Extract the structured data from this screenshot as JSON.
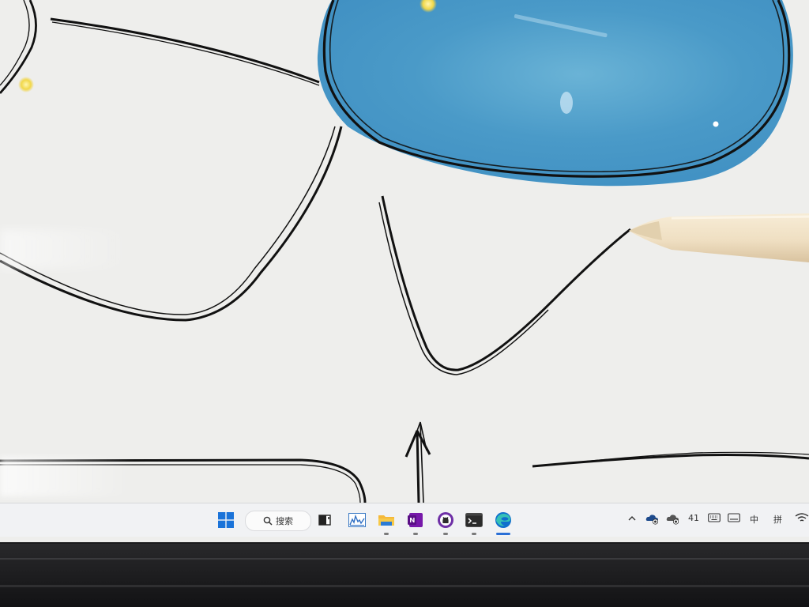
{
  "taskbar": {
    "search": {
      "label": "搜索"
    },
    "apps": [
      {
        "name": "start",
        "icon": "windows-logo-icon"
      },
      {
        "name": "search",
        "icon": "search-icon"
      },
      {
        "name": "task-view",
        "icon": "task-view-icon"
      },
      {
        "name": "performance",
        "icon": "performance-chart-icon"
      },
      {
        "name": "file-explorer",
        "icon": "folder-icon",
        "running": true
      },
      {
        "name": "onenote",
        "icon": "onenote-icon",
        "running": true
      },
      {
        "name": "github",
        "icon": "github-icon",
        "running": true
      },
      {
        "name": "terminal",
        "icon": "terminal-icon",
        "running": true
      },
      {
        "name": "edge",
        "icon": "edge-icon",
        "active": true
      }
    ],
    "tray": {
      "overflow_icon": "chevron-up-icon",
      "cloud_icon": "onedrive-icon",
      "status_icon": "cloud-status-icon",
      "count": "41",
      "keyboard_icon": "keyboard-icon",
      "tablet_icon": "touchpad-icon",
      "ime_mode": "中",
      "ime_input": "拼",
      "wifi_icon": "wifi-icon"
    }
  },
  "canvas": {
    "ink_color": "#111111",
    "fill_color": "#4a9ac8",
    "background": "#eeeeec"
  }
}
